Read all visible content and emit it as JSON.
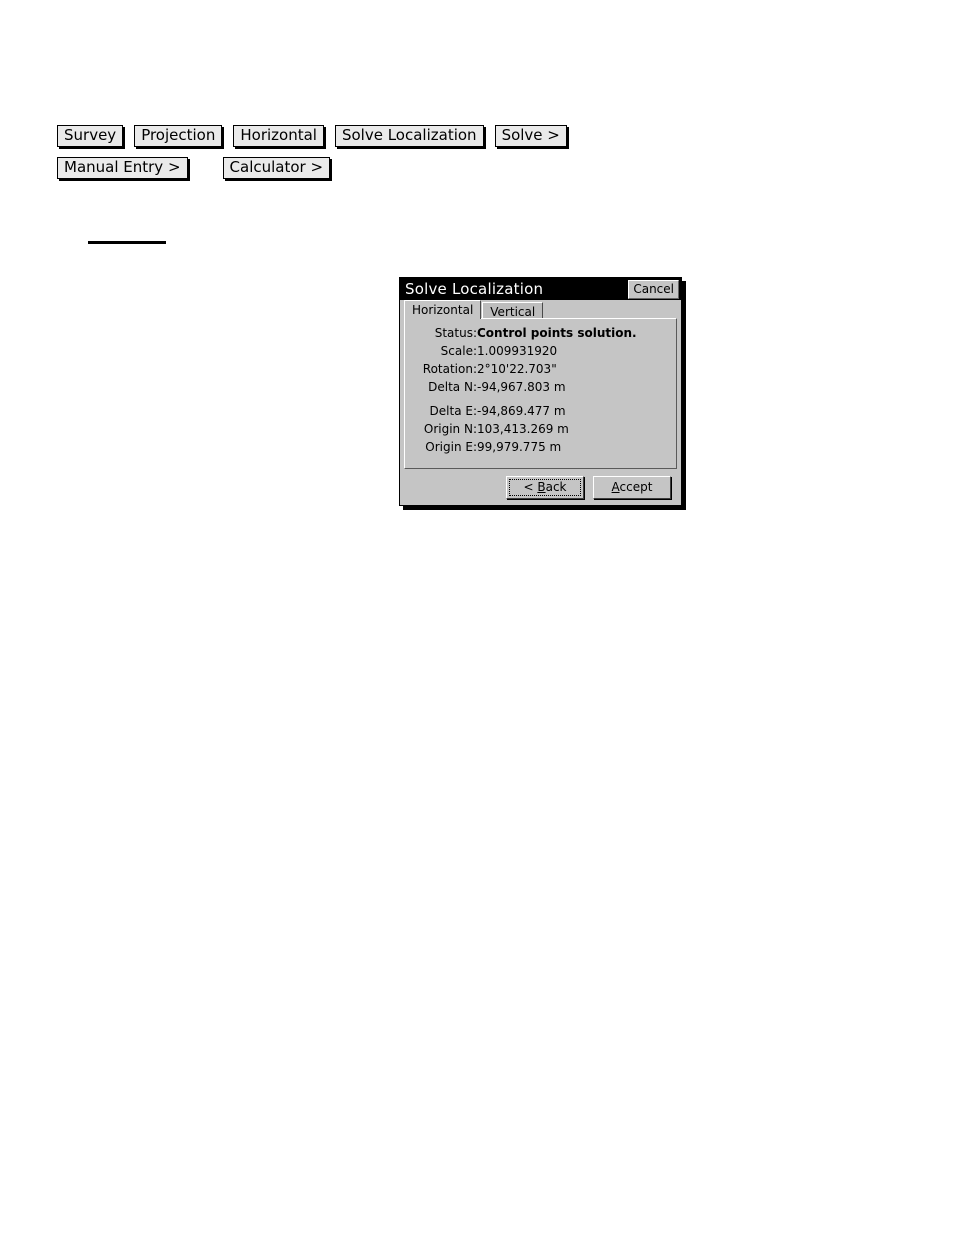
{
  "breadcrumb": {
    "row1": [
      {
        "label": "Survey"
      },
      {
        "label": "Projection"
      },
      {
        "label": "Horizontal"
      },
      {
        "label": "Solve Localization"
      },
      {
        "label": "Solve >"
      }
    ],
    "row2": [
      {
        "label": "Manual Entry >"
      },
      {
        "label": "Calculator >"
      }
    ]
  },
  "dialog": {
    "title": "Solve Localization",
    "cancel_label": "Cancel",
    "tabs": [
      {
        "label": "Horizontal",
        "active": true
      },
      {
        "label": "Vertical",
        "active": false
      }
    ],
    "fields": [
      {
        "label": "Status:",
        "value": "Control points solution."
      },
      {
        "label": "Scale:",
        "value": "1.009931920"
      },
      {
        "label": "Rotation:",
        "value": "2°10'22.703\""
      },
      {
        "label": "Delta N:",
        "value": "-94,967.803 m"
      },
      {
        "label": "Delta E:",
        "value": "-94,869.477 m"
      },
      {
        "label": "Origin N:",
        "value": "103,413.269 m"
      },
      {
        "label": "Origin E:",
        "value": "99,979.775 m"
      }
    ],
    "buttons": {
      "back": {
        "prefix": "< ",
        "accel": "B",
        "rest": "ack"
      },
      "accept": {
        "prefix": "",
        "accel": "A",
        "rest": "ccept"
      }
    }
  },
  "colors": {
    "dialog_face": "#c5c5c5",
    "titlebar": "#000000",
    "titlebar_text": "#ffffff",
    "page_background": "#ffffff"
  }
}
